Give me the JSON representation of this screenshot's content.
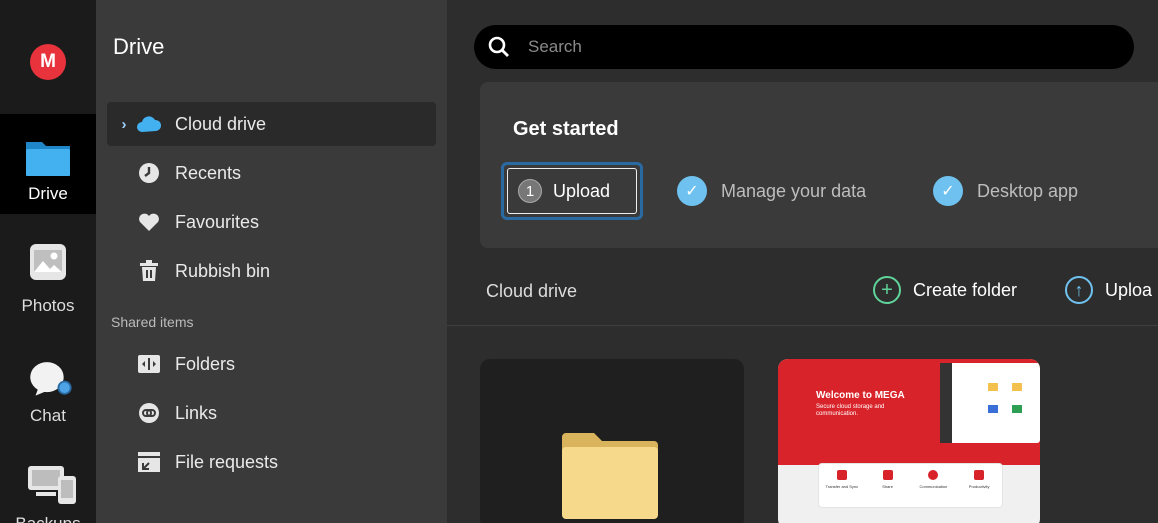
{
  "app": {
    "logo_letter": "M",
    "brand_color": "#e8323c",
    "accent": "#6fc2ef"
  },
  "rail": {
    "items": [
      {
        "label": "Drive",
        "icon": "folder-icon",
        "active": true
      },
      {
        "label": "Photos",
        "icon": "photos-icon"
      },
      {
        "label": "Chat",
        "icon": "chat-icon"
      },
      {
        "label": "Backups",
        "icon": "devices-icon"
      }
    ]
  },
  "sidebar": {
    "title": "Drive",
    "items": [
      {
        "label": "Cloud drive",
        "icon": "cloud-icon",
        "expand": "›"
      },
      {
        "label": "Recents",
        "icon": "clock-icon"
      },
      {
        "label": "Favourites",
        "icon": "heart-icon"
      },
      {
        "label": "Rubbish bin",
        "icon": "trash-icon"
      }
    ],
    "shared_section": "Shared items",
    "shared_items": [
      {
        "label": "Folders",
        "icon": "shared-folders-icon"
      },
      {
        "label": "Links",
        "icon": "link-icon"
      },
      {
        "label": "File requests",
        "icon": "file-request-icon"
      }
    ]
  },
  "search": {
    "placeholder": "Search"
  },
  "get_started": {
    "title": "Get started",
    "steps": [
      {
        "number": "1",
        "label": "Upload"
      },
      {
        "label": "Manage your data",
        "done": true
      },
      {
        "label": "Desktop app",
        "done": true
      }
    ]
  },
  "toolbar": {
    "title": "Cloud drive",
    "create_folder": "Create folder",
    "upload": "Uploa"
  },
  "thumbnail": {
    "heading": "Welcome to MEGA",
    "subtext": "Secure cloud storage and communication.",
    "features": [
      "Transfer and Sync",
      "Share",
      "Communication",
      "Productivity"
    ]
  }
}
